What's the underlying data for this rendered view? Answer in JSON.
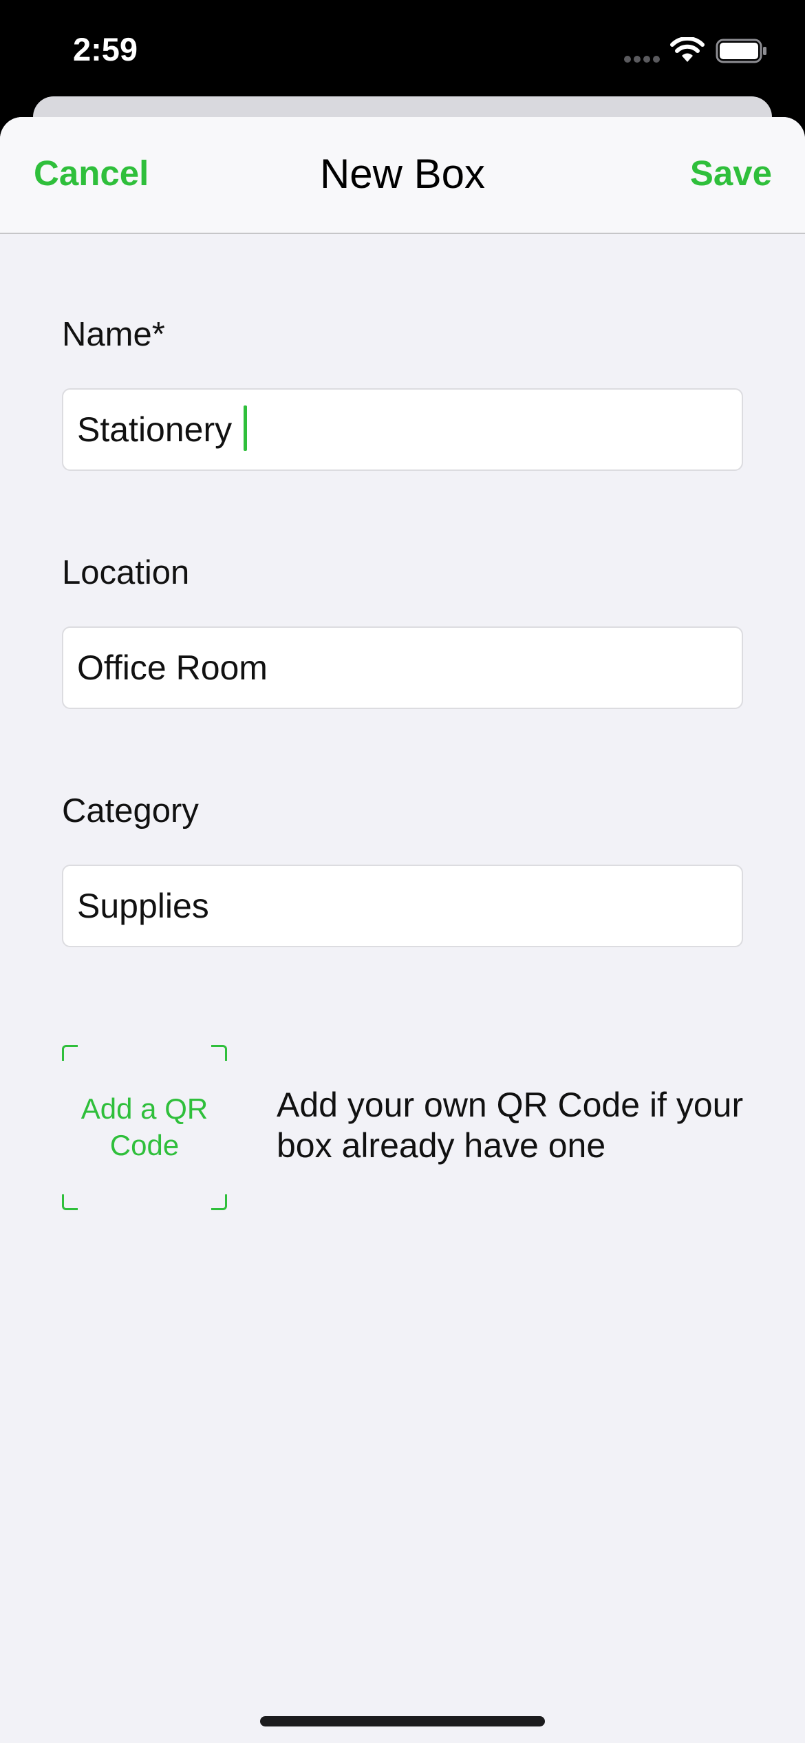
{
  "status_bar": {
    "time": "2:59",
    "icons": [
      "cellular-signal-icon",
      "wifi-icon",
      "battery-icon"
    ]
  },
  "nav": {
    "cancel_label": "Cancel",
    "title": "New Box",
    "save_label": "Save"
  },
  "form": {
    "name": {
      "label": "Name*",
      "value": "Stationery"
    },
    "location": {
      "label": "Location",
      "value": "Office Room"
    },
    "category": {
      "label": "Category",
      "value": "Supplies"
    }
  },
  "qr": {
    "button_label": "Add a QR Code",
    "hint": "Add your own QR Code if your box already have one"
  },
  "colors": {
    "accent": "#2fbf3b",
    "background": "#f2f2f7",
    "nav_background": "#f8f8fa",
    "status_bar": "#000000",
    "field_background": "#ffffff"
  }
}
